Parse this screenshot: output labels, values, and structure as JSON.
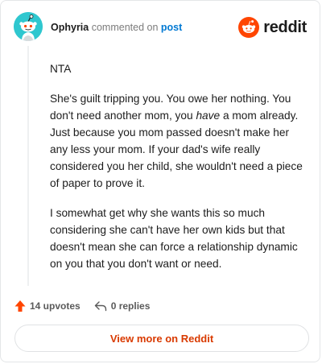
{
  "header": {
    "author": "Ophyria",
    "action_text": "commented on",
    "post_link": "post",
    "brand": "reddit"
  },
  "comment": {
    "paragraphs": [
      "NTA",
      "She's guilt tripping you. You owe her nothing. You don't need another mom, you",
      "I somewhat get why she wants this so much considering she can't have her own kids but that doesn't mean she can force a relationship dynamic on you that you don't want or need."
    ],
    "p2_emphasis": "have",
    "p2_rest": "a mom already. Just because you mom passed doesn't make her any less your mom. If your dad's wife really considered you her child, she wouldn't need a piece of paper to prove it."
  },
  "footer": {
    "upvotes": "14 upvotes",
    "replies": "0 replies",
    "view_more": "View more on Reddit"
  },
  "colors": {
    "upvote_arrow": "#ff4500",
    "link_blue": "#0079d3",
    "view_more_text": "#d93a00",
    "avatar_bg": "#2fc7cf",
    "brand_orange": "#ff4500"
  },
  "icons": {
    "avatar": "snoo-avatar-icon",
    "brand": "reddit-logo-icon",
    "upvote": "upvote-arrow-icon",
    "reply": "reply-arrow-icon"
  }
}
